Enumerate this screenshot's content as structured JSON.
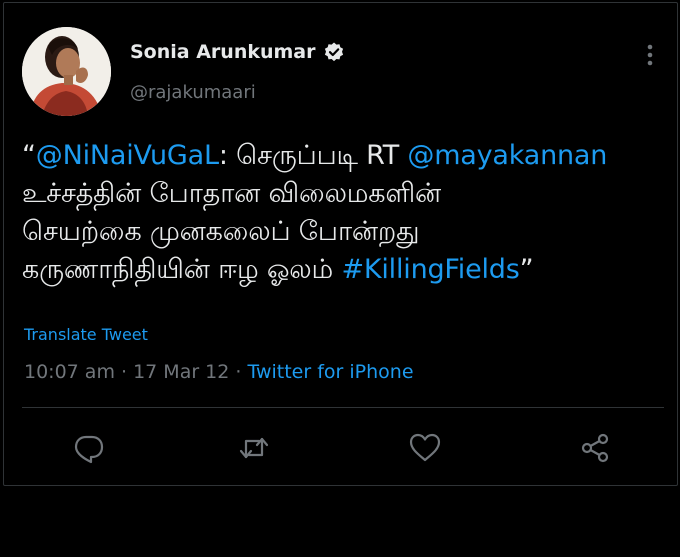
{
  "user": {
    "display_name": "Sonia Arunkumar",
    "handle": "@rajakumaari",
    "verified": true
  },
  "tweet": {
    "open_quote": "“",
    "mention_1": "@NiNaiVuGaL",
    "text_1": ": செருப்படி RT ",
    "mention_2": "@mayakannan",
    "line_2": "உச்சத்தின் போதான விலைமகளின்",
    "line_3": "செயற்கை முனகலைப் போன்றது",
    "line_4_text": "கருணாநிதியின் ஈழ ஓலம் ",
    "hashtag": "#KillingFields",
    "close_quote": "”"
  },
  "translate_label": "Translate Tweet",
  "meta": {
    "time": "10:07 am",
    "sep_1": " · ",
    "date": "17 Mar 12",
    "sep_2": " · ",
    "source": "Twitter for iPhone"
  },
  "icons": {
    "verified": "verified-badge-icon",
    "more": "more-vertical-icon",
    "reply": "reply-icon",
    "retweet": "retweet-icon",
    "like": "like-icon",
    "share": "share-icon"
  },
  "colors": {
    "background": "#000000",
    "text": "#e7e9ea",
    "secondary": "#71767b",
    "accent": "#1d9bf0",
    "border": "#2f3336"
  }
}
